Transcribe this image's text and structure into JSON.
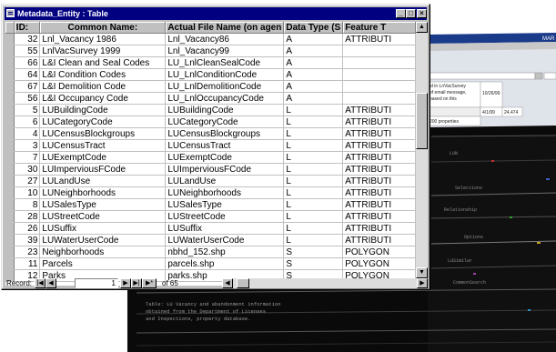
{
  "background": {
    "table_cells": [
      "id in LnVacSurvey",
      "of email message,",
      "based on this",
      "10/26/99",
      "4/1/99",
      "24,474",
      "200 properties"
    ],
    "dark_text": [
      "LUN",
      "Selections",
      "Relationship",
      "Options",
      "LUSimilar",
      "CommonSearch"
    ],
    "caption_lines": [
      "Table: LU Vacancy and abandonment information",
      "obtained from the Department of Licenses",
      "and Inspections, property database."
    ]
  },
  "window": {
    "title": "Metadata_Entity : Table",
    "min_label": "_",
    "max_label": "□",
    "close_label": "×"
  },
  "columns": [
    "ID:",
    "Common Name:",
    "Actual File Name (on agen",
    "Data Type (S",
    "Feature T"
  ],
  "rows": [
    {
      "id": "32",
      "name": "Lnl_Vacancy 1986",
      "file": "Lnl_Vacancy86",
      "type": "A",
      "feature": "ATTRIBUTI"
    },
    {
      "id": "55",
      "name": "LnlVacSurvey 1999",
      "file": "Lnl_Vacancy99",
      "type": "A",
      "feature": ""
    },
    {
      "id": "66",
      "name": "L&I Clean and Seal Codes",
      "file": "LU_LnlCleanSealCode",
      "type": "A",
      "feature": ""
    },
    {
      "id": "64",
      "name": "L&I Condition Codes",
      "file": "LU_LnlConditionCode",
      "type": "A",
      "feature": ""
    },
    {
      "id": "67",
      "name": "L&I Demolition Code",
      "file": "LU_LnlDemolitionCode",
      "type": "A",
      "feature": ""
    },
    {
      "id": "56",
      "name": "L&I Occupancy Code",
      "file": "LU_LnlOccupancyCode",
      "type": "A",
      "feature": ""
    },
    {
      "id": "5",
      "name": "LUBuildingCode",
      "file": "LUBuildingCode",
      "type": "L",
      "feature": "ATTRIBUTI"
    },
    {
      "id": "6",
      "name": "LUCategoryCode",
      "file": "LUCategoryCode",
      "type": "L",
      "feature": "ATTRIBUTI"
    },
    {
      "id": "4",
      "name": "LUCensusBlockgroups",
      "file": "LUCensusBlockgroups",
      "type": "L",
      "feature": "ATTRIBUTI"
    },
    {
      "id": "3",
      "name": "LUCensusTract",
      "file": "LUCensusTract",
      "type": "L",
      "feature": "ATTRIBUTI"
    },
    {
      "id": "7",
      "name": "LUExemptCode",
      "file": "LUExemptCode",
      "type": "L",
      "feature": "ATTRIBUTI"
    },
    {
      "id": "30",
      "name": "LUImperviousFCode",
      "file": "LUImperviousFCode",
      "type": "L",
      "feature": "ATTRIBUTI"
    },
    {
      "id": "27",
      "name": "LULandUse",
      "file": "LULandUse",
      "type": "L",
      "feature": "ATTRIBUTI"
    },
    {
      "id": "10",
      "name": "LUNeighborhoods",
      "file": "LUNeighborhoods",
      "type": "L",
      "feature": "ATTRIBUTI"
    },
    {
      "id": "8",
      "name": "LUSalesType",
      "file": "LUSalesType",
      "type": "L",
      "feature": "ATTRIBUTI"
    },
    {
      "id": "28",
      "name": "LUStreetCode",
      "file": "LUStreetCode",
      "type": "L",
      "feature": "ATTRIBUTI"
    },
    {
      "id": "26",
      "name": "LUSuffix",
      "file": "LUSuffix",
      "type": "L",
      "feature": "ATTRIBUTI"
    },
    {
      "id": "39",
      "name": "LUWaterUserCode",
      "file": "LUWaterUserCode",
      "type": "L",
      "feature": "ATTRIBUTI"
    },
    {
      "id": "23",
      "name": "Neighborhoods",
      "file": "nbhd_152.shp",
      "type": "S",
      "feature": "POLYGON"
    },
    {
      "id": "11",
      "name": "Parcels",
      "file": "parcels.shp",
      "type": "S",
      "feature": "POLYGON"
    },
    {
      "id": "12",
      "name": "Parks",
      "file": "parks.shp",
      "type": "S",
      "feature": "POLYGON"
    }
  ],
  "navigator": {
    "label": "Record:",
    "current": "1",
    "of_label": "of",
    "total": "65",
    "first": "|◀",
    "prev": "◀",
    "next": "▶",
    "last": "▶|",
    "new": "▶*"
  },
  "colors": {
    "titlebar": "#000080",
    "window_face": "#c0c0c0",
    "background_dark": "#0a0a0a",
    "background_light": "#e8e8e8"
  }
}
